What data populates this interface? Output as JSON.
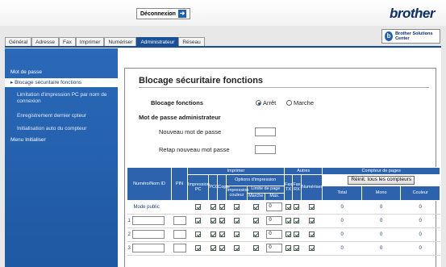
{
  "header": {
    "logout_label": "Déconnexion",
    "brand": "brother",
    "solutions": "Brother Solutions Center"
  },
  "tabs": [
    {
      "label": "Général",
      "active": false
    },
    {
      "label": "Adresse",
      "active": false
    },
    {
      "label": "Fax",
      "active": false
    },
    {
      "label": "Imprimer",
      "active": false
    },
    {
      "label": "Numériser",
      "active": false
    },
    {
      "label": "Administrateur",
      "active": true
    },
    {
      "label": "Réseau",
      "active": false
    }
  ],
  "sidebar": {
    "items": [
      {
        "label": "Mot de passe"
      },
      {
        "label": "Blocage sécuritaire fonctions"
      },
      {
        "label": "Limitation d'impression PC par nom de connexion"
      },
      {
        "label": "Enregistrement dernier cpteur"
      },
      {
        "label": "Initialisation auto du compteur"
      },
      {
        "label": "Menu Initialiser"
      }
    ]
  },
  "page": {
    "title": "Blocage sécuritaire fonctions",
    "lock_label": "Blocage fonctions",
    "option_off": "Arrêt",
    "option_on": "Marche",
    "admin_pw_label": "Mot de passe administrateur",
    "new_pw_label": "Nouveau mot de passe",
    "retype_pw_label": "Retap nouveau mot passe"
  },
  "table": {
    "h_imprimer": "Imprimer",
    "h_autres": "Autres",
    "h_compteur": "Compteur de pages",
    "h_numero": "Numéro/Nom ID",
    "h_pin": "PIN",
    "h_impression_pc": "Impression PC",
    "h_pcc": "PCC",
    "h_copie": "Copie",
    "h_options": "Options d'impression",
    "h_impression_couleur": "Impression couleur",
    "h_limite": "Limite de page",
    "h_marche": "Marche",
    "h_max": "Max.",
    "h_fax_tx": "Fax TX",
    "h_fax_rx": "Fax RX",
    "h_numeriser": "Numériser",
    "reset_button": "Réinit. tous les compteurs",
    "h_total": "Total",
    "h_mono": "Mono",
    "h_couleur": "Couleur",
    "rows": [
      {
        "num": "",
        "name": "Mode public",
        "max": "0",
        "total": "0",
        "mono": "0",
        "couleur": "0"
      },
      {
        "num": "1",
        "name": "",
        "max": "0",
        "total": "0",
        "mono": "0",
        "couleur": "0"
      },
      {
        "num": "2",
        "name": "",
        "max": "0",
        "total": "0",
        "mono": "0",
        "couleur": "0"
      },
      {
        "num": "3",
        "name": "",
        "max": "0",
        "total": "0",
        "mono": "0",
        "couleur": "0"
      }
    ]
  }
}
